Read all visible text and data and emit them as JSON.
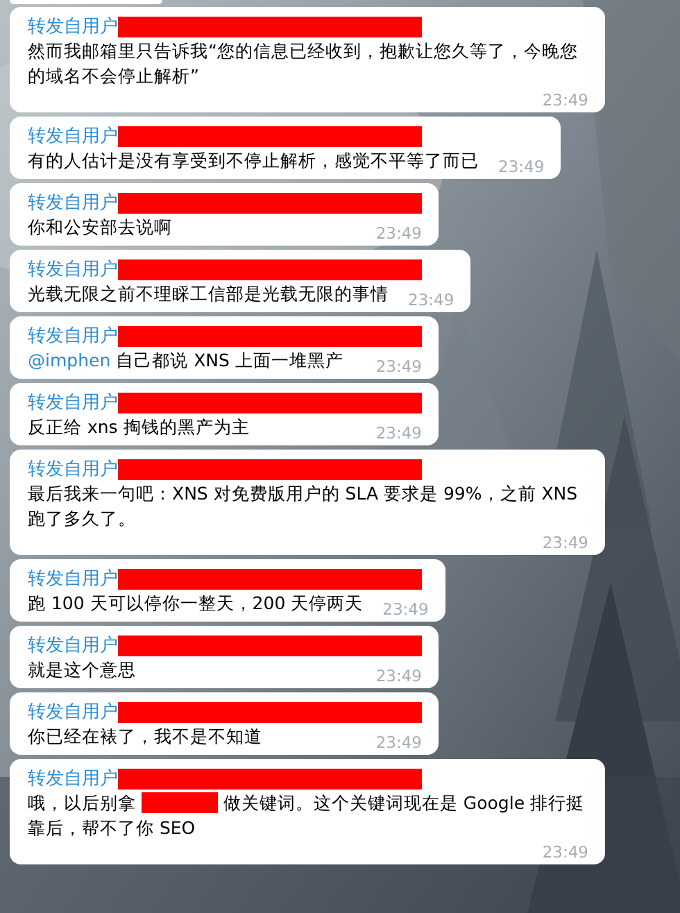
{
  "messages": [
    {
      "forwarded_from": "转发自用户",
      "body": [
        {
          "kind": "text",
          "text": "然而我邮箱里只告诉我“您的信息已经收到，抱歉让您久等了，今晚您的域名不会停止解析”"
        }
      ],
      "time": "23:49"
    },
    {
      "forwarded_from": "转发自用户",
      "body": [
        {
          "kind": "text",
          "text": "有的人估计是没有享受到不停止解析，感觉不平等了而已"
        }
      ],
      "time": "23:49"
    },
    {
      "forwarded_from": "转发自用户",
      "body": [
        {
          "kind": "text",
          "text": "你和公安部去说啊"
        }
      ],
      "time": "23:49"
    },
    {
      "forwarded_from": "转发自用户",
      "body": [
        {
          "kind": "text",
          "text": "光载无限之前不理睬工信部是光载无限的事情"
        }
      ],
      "time": "23:49"
    },
    {
      "forwarded_from": "转发自用户",
      "body": [
        {
          "kind": "mention",
          "text": "@imphen"
        },
        {
          "kind": "text",
          "text": " 自己都说 XNS 上面一堆黑产"
        }
      ],
      "time": "23:49"
    },
    {
      "forwarded_from": "转发自用户",
      "body": [
        {
          "kind": "text",
          "text": "反正给 xns 掏钱的黑产为主"
        }
      ],
      "time": "23:49"
    },
    {
      "forwarded_from": "转发自用户",
      "body": [
        {
          "kind": "text",
          "text": "最后我来一句吧：XNS 对免费版用户的 SLA 要求是 99%，之前 XNS 跑了多久了。"
        }
      ],
      "time": "23:49"
    },
    {
      "forwarded_from": "转发自用户",
      "body": [
        {
          "kind": "text",
          "text": "跑 100 天可以停你一整天，200 天停两天"
        }
      ],
      "time": "23:49"
    },
    {
      "forwarded_from": "转发自用户",
      "body": [
        {
          "kind": "text",
          "text": "就是这个意思"
        }
      ],
      "time": "23:49"
    },
    {
      "forwarded_from": "转发自用户",
      "body": [
        {
          "kind": "text",
          "text": "你已经在裱了，我不是不知道"
        }
      ],
      "time": "23:49"
    },
    {
      "forwarded_from": "转发自用户",
      "body": [
        {
          "kind": "text",
          "text": "哦，以后别拿 "
        },
        {
          "kind": "redaction"
        },
        {
          "kind": "text",
          "text": " 做关键词。这个关键词现在是 Google 排行挺靠后，帮不了你 SEO"
        }
      ],
      "time": "23:49"
    }
  ]
}
